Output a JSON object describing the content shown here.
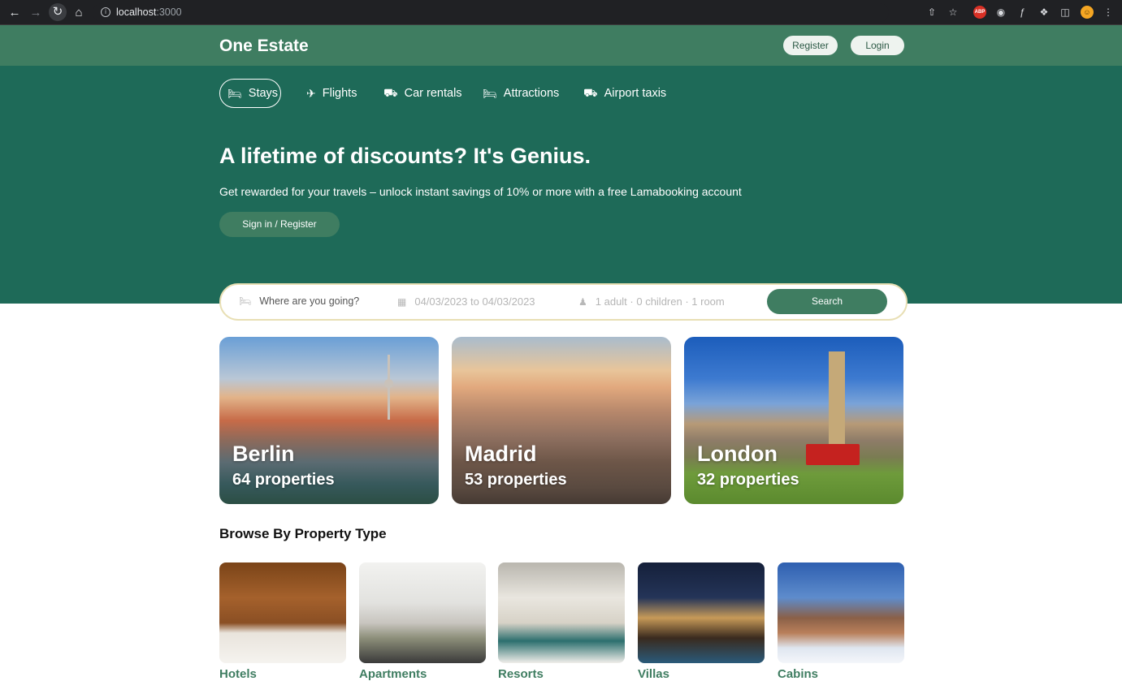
{
  "browser": {
    "url_host": "localhost",
    "url_port": ":3000",
    "abp_label": "ABP"
  },
  "navbar": {
    "logo": "One Estate",
    "register_label": "Register",
    "login_label": "Login"
  },
  "tabs": [
    {
      "label": "Stays",
      "icon": "bed-icon"
    },
    {
      "label": "Flights",
      "icon": "plane-icon"
    },
    {
      "label": "Car rentals",
      "icon": "car-icon"
    },
    {
      "label": "Attractions",
      "icon": "bed-icon"
    },
    {
      "label": "Airport taxis",
      "icon": "taxi-icon"
    }
  ],
  "hero": {
    "title": "A lifetime of discounts? It's Genius.",
    "description": "Get rewarded for your travels – unlock instant savings of 10% or more with a free Lamabooking account",
    "signin_label": "Sign in / Register"
  },
  "search": {
    "destination_placeholder": "Where are you going?",
    "date_range": "04/03/2023 to 04/03/2023",
    "options": "1 adult · 0 children · 1 room",
    "button_label": "Search"
  },
  "featured": [
    {
      "city": "Berlin",
      "properties": "64 properties"
    },
    {
      "city": "Madrid",
      "properties": "53 properties"
    },
    {
      "city": "London",
      "properties": "32 properties"
    }
  ],
  "property_section": {
    "title": "Browse By Property Type",
    "types": [
      {
        "label": "Hotels"
      },
      {
        "label": "Apartments"
      },
      {
        "label": "Resorts"
      },
      {
        "label": "Villas"
      },
      {
        "label": "Cabins"
      }
    ]
  },
  "colors": {
    "navbar": "#3f7d61",
    "hero": "#1e6a58",
    "accent": "#3f7d61",
    "search_border": "#e8dfb4"
  }
}
